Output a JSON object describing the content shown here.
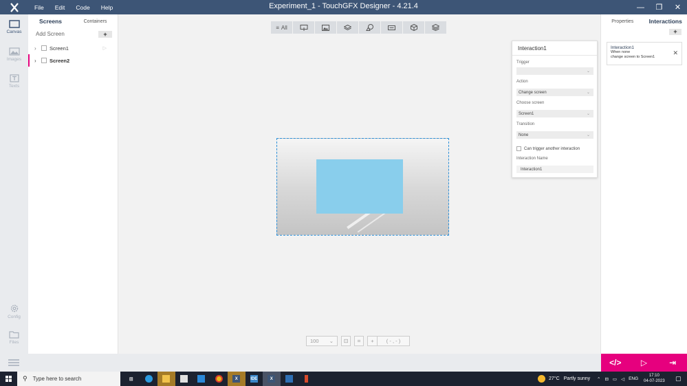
{
  "app": {
    "title": "Experiment_1 - TouchGFX Designer - 4.21.4",
    "menu": [
      "File",
      "Edit",
      "Code",
      "Help"
    ],
    "brand_color": "#3d5576",
    "accent_color": "#e6007e"
  },
  "iconbar": {
    "items": [
      {
        "label": "Canvas",
        "icon": "canvas-icon"
      },
      {
        "label": "Images",
        "icon": "images-icon"
      },
      {
        "label": "Texts",
        "icon": "texts-icon"
      },
      {
        "label": "Config",
        "icon": "gear-icon"
      },
      {
        "label": "Files",
        "icon": "folder-icon"
      }
    ]
  },
  "screens_panel": {
    "tabs": [
      "Screens",
      "Containers"
    ],
    "add_label": "Add Screen",
    "add_button": "+",
    "items": [
      {
        "label": "Screen1",
        "active": false
      },
      {
        "label": "Screen2",
        "active": true
      }
    ]
  },
  "canvas": {
    "toolbar_all": "All",
    "zoom": "100",
    "coords": "( - , - )",
    "widget_color": "#89ceec"
  },
  "interaction_popup": {
    "title": "Interaction1",
    "trigger_label": "Trigger",
    "trigger_value": "",
    "action_label": "Action",
    "action_value": "Change screen",
    "choose_screen_label": "Choose screen",
    "choose_screen_value": "Screen1",
    "transition_label": "Transition",
    "transition_value": "None",
    "can_trigger_label": "Can trigger another interaction",
    "name_label": "Interaction Name",
    "name_value": "Interaction1"
  },
  "right_panel": {
    "tabs": [
      "Properties",
      "Interactions"
    ],
    "add_button": "+",
    "card": {
      "title": "Interaction1",
      "line1": "When none",
      "line2": "change screen to Screen1"
    }
  },
  "bottom_actions": {
    "code": "</>",
    "run": "▷",
    "export": "⇥"
  },
  "taskbar": {
    "search_placeholder": "Type here to search",
    "weather_temp": "27°C",
    "weather_text": "Partly sunny",
    "lang": "ENG",
    "time": "17:10",
    "date": "04-07-2023"
  }
}
